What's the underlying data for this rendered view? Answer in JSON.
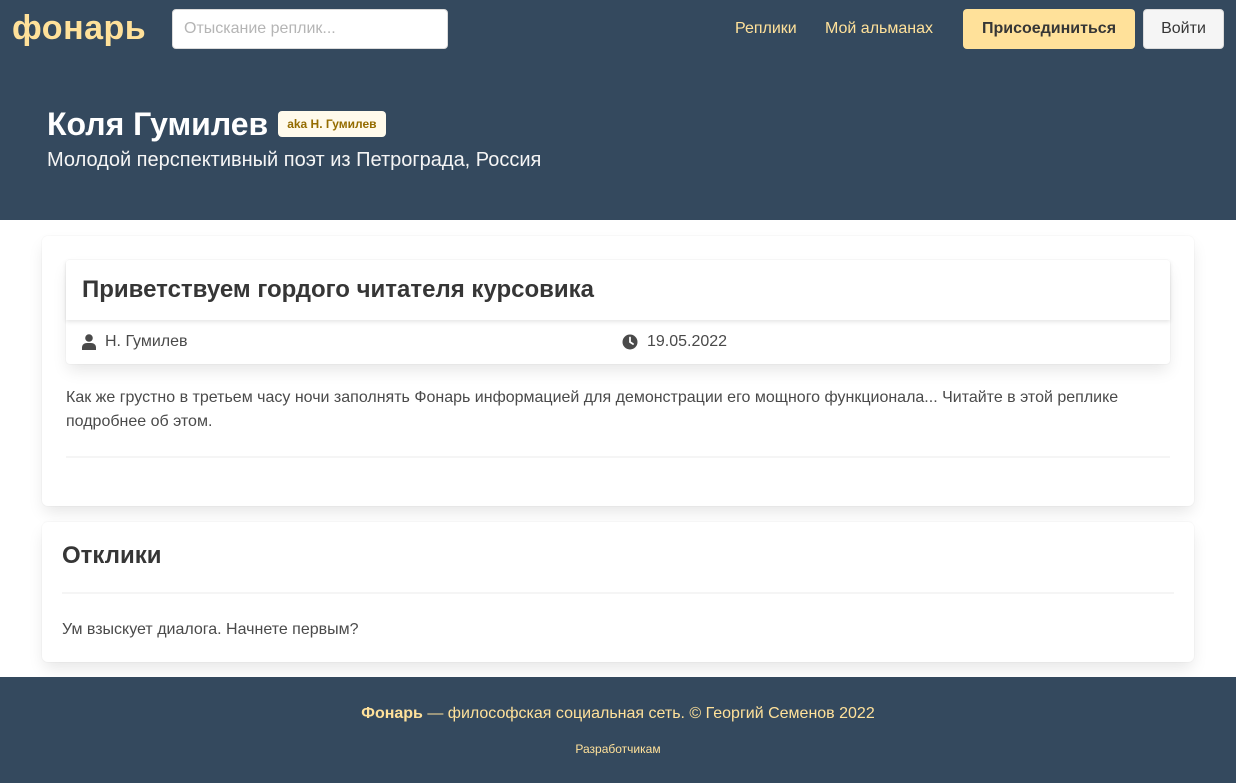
{
  "navbar": {
    "brand": "фонарь",
    "search_placeholder": "Отыскание реплик...",
    "links": {
      "replies": "Реплики",
      "almanac": "Мой альманах"
    },
    "join_label": "Присоединиться",
    "login_label": "Войти"
  },
  "hero": {
    "name": "Коля Гумилев",
    "alias": "aka Н. Гумилев",
    "subtitle": "Молодой перспективный поэт из Петрограда, Россия"
  },
  "post": {
    "title": "Приветствуем гордого читателя курсовика",
    "author": "Н. Гумилев",
    "date": "19.05.2022",
    "author_icon": "user-icon",
    "date_icon": "clock-icon",
    "text": "Как же грустно в третьем часу ночи заполнять Фонарь информацией для демонстрации его мощного функционала... Читайте в этой реплике подробнее об этом."
  },
  "responses": {
    "title": "Отклики",
    "empty_text": "Ум взыскует диалога. Начнете первым?"
  },
  "footer": {
    "brand": "Фонарь",
    "tagline": " — философская социальная сеть. © Георгий Семенов 2022",
    "developers_link": "Разработчикам"
  },
  "colors": {
    "primary_dark": "#34495e",
    "accent": "#ffe19a",
    "alias_tag_bg": "#fffaeb",
    "alias_tag_text": "#946c00"
  }
}
